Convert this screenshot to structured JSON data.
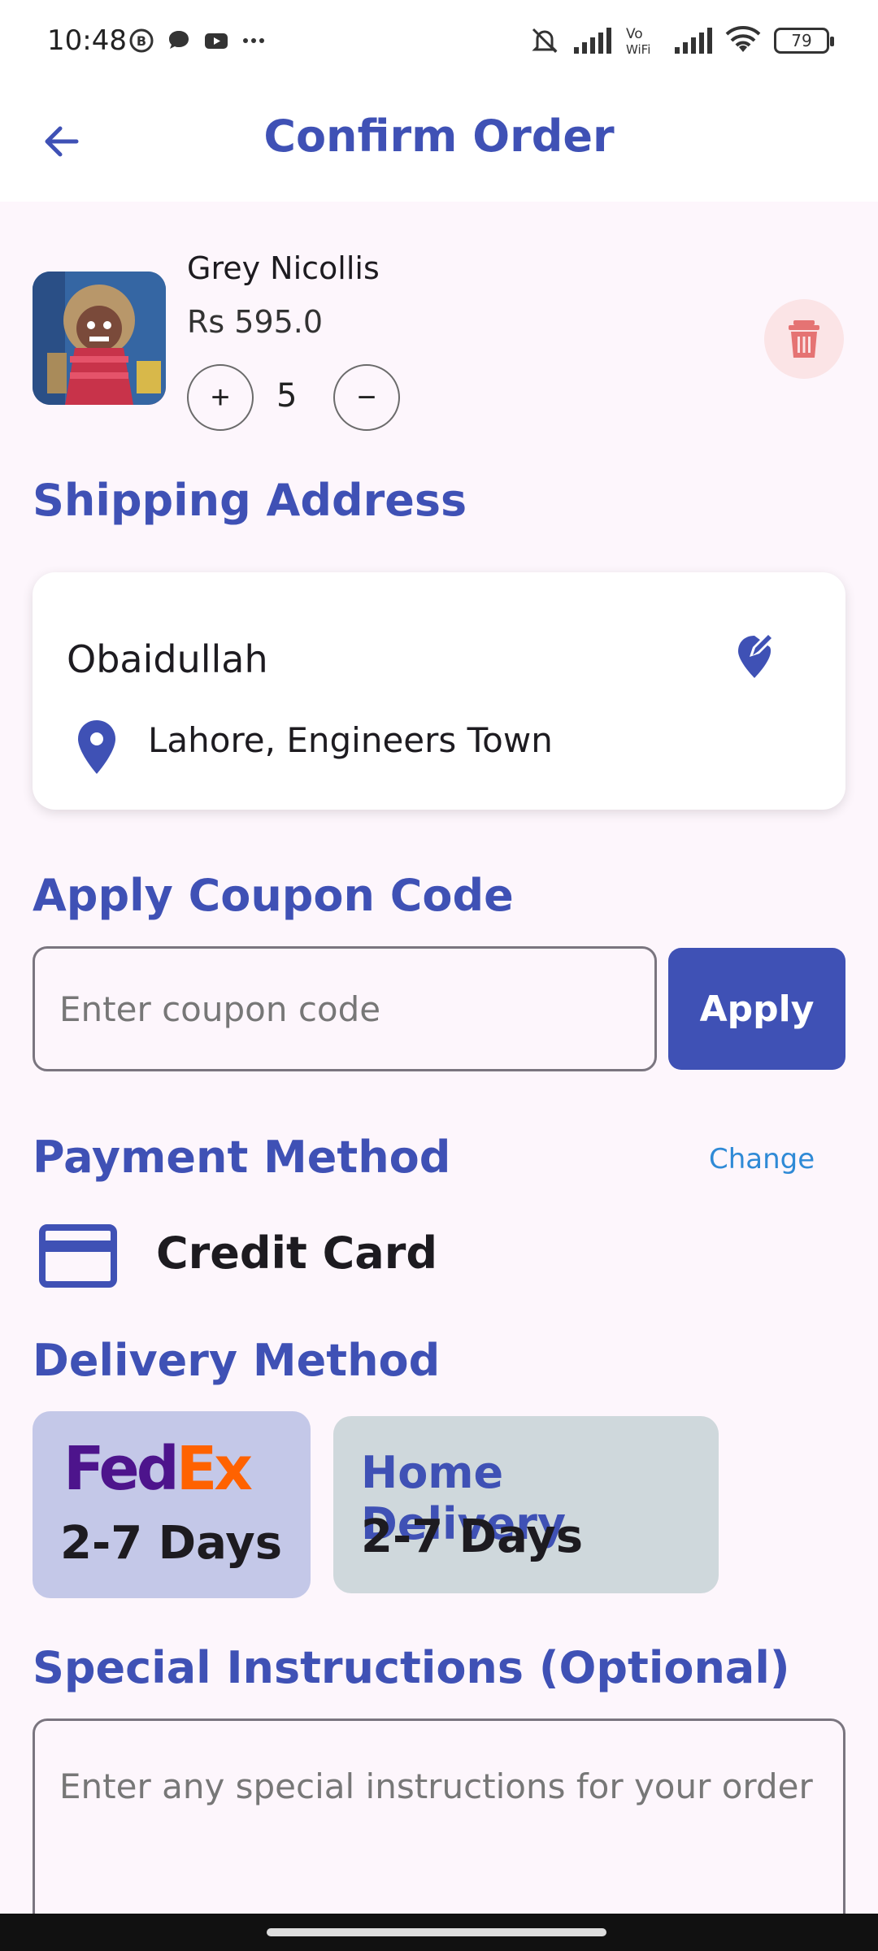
{
  "status_bar": {
    "time": "10:48",
    "battery": "79"
  },
  "app_bar": {
    "title": "Confirm Order"
  },
  "cart_item": {
    "name": "Grey Nicollis",
    "price": "Rs 595.0",
    "quantity": "5",
    "plus_symbol": "+",
    "minus_symbol": "−"
  },
  "shipping": {
    "heading": "Shipping Address",
    "name": "Obaidullah",
    "address": "Lahore, Engineers Town"
  },
  "coupon": {
    "heading": "Apply Coupon Code",
    "placeholder": "Enter coupon code",
    "apply_label": "Apply"
  },
  "payment": {
    "heading": "Payment Method",
    "change_label": "Change",
    "method": "Credit Card"
  },
  "delivery": {
    "heading": "Delivery Method",
    "options": [
      {
        "logo_part1": "Fed",
        "logo_part2": "Ex",
        "days": "2-7 Days",
        "selected": true
      },
      {
        "title": "Home Delivery",
        "days": "2-7 Days",
        "selected": false
      }
    ]
  },
  "instructions": {
    "heading": "Special Instructions (Optional)",
    "placeholder": "Enter any special instructions for your order"
  },
  "colors": {
    "primary": "#3f51b5",
    "background": "#fdf6fc",
    "delete_bg": "#fbe4e6",
    "delete_icon": "#e57373",
    "link": "#2f8ad6"
  }
}
